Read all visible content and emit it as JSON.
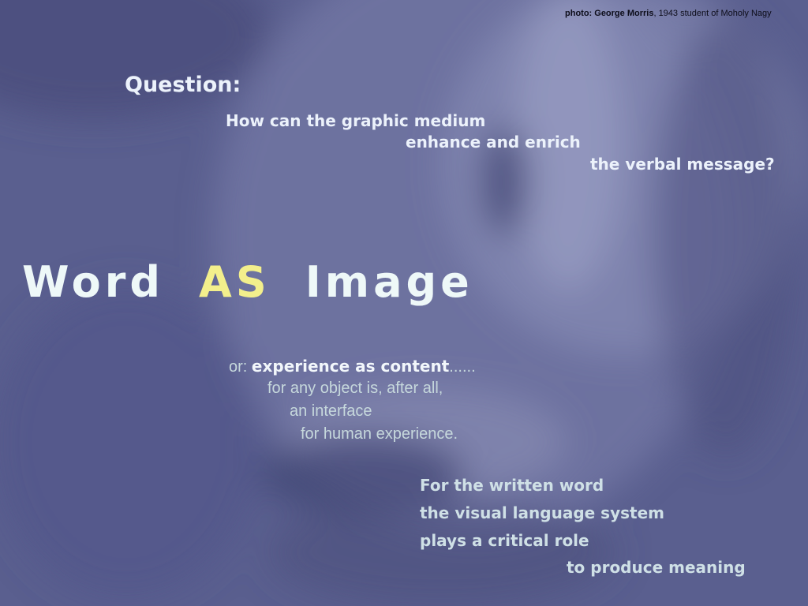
{
  "credit": {
    "bold": "photo: George Morris",
    "rest": ", 1943 student of Moholy Nagy"
  },
  "question": {
    "label": "Question:",
    "lines": [
      "How can the graphic medium",
      "enhance and enrich",
      "the verbal message?"
    ]
  },
  "headline": {
    "word1": "Word",
    "word2": "AS",
    "word3": "Image"
  },
  "experience": {
    "prefix": "or: ",
    "emphasis": "experience as content",
    "suffix": "......",
    "lines": [
      "for any object is, after all,",
      "an interface",
      "for human experience."
    ]
  },
  "written_word": {
    "lines": [
      "For the written word",
      "the visual language system",
      "plays a critical role",
      "to produce meaning"
    ]
  },
  "colors": {
    "background": "#585d8c",
    "text_light": "#eef8f8",
    "accent": "#f3ef8c"
  }
}
